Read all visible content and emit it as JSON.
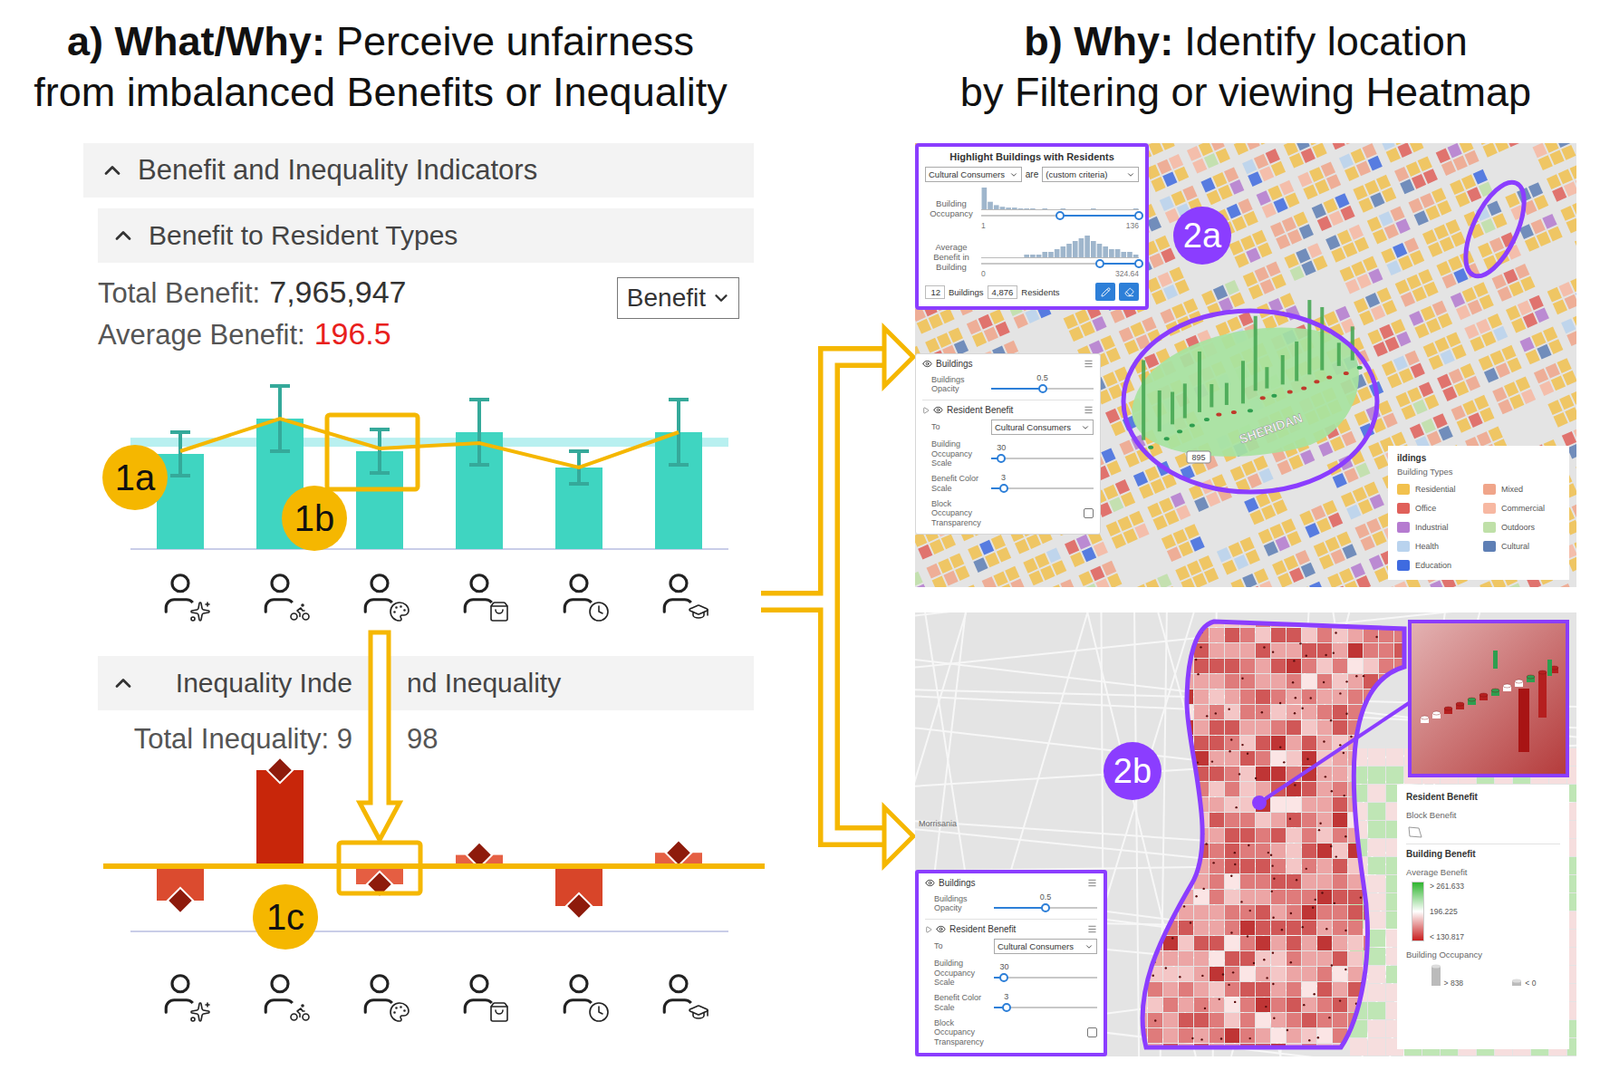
{
  "left": {
    "title": {
      "bold": "a) What/Why:",
      "line1": "Perceive unfairness",
      "line2": "from imbalanced Benefits or Inequality"
    },
    "indicators": {
      "label": "Benefit and Inequality Indicators",
      "expanded": true
    },
    "benefit": {
      "label": "Benefit to Resident Types",
      "expanded": true,
      "total_label": "Total Benefit:",
      "total": "7,965,947",
      "average_label": "Average Benefit:",
      "average": "196.5",
      "select": "Benefit",
      "mean": 196.5,
      "bars": [
        {
          "value": 175,
          "error": 40,
          "trend": 180,
          "selected": false
        },
        {
          "value": 240,
          "error": 60,
          "trend": 240,
          "selected": false
        },
        {
          "value": 180,
          "error": 40,
          "trend": 185,
          "selected": true
        },
        {
          "value": 215,
          "error": 60,
          "trend": 195,
          "selected": false
        },
        {
          "value": 150,
          "error": 30,
          "trend": 150,
          "selected": false
        },
        {
          "value": 215,
          "error": 60,
          "trend": 215,
          "selected": false
        }
      ]
    },
    "inequality": {
      "label_before": "Inequality Inde",
      "label_after": "nd Inequality",
      "expanded": true,
      "total_before": "Total Inequality: 9",
      "total_after": "98",
      "bars": [
        {
          "value": -30,
          "selected": false
        },
        {
          "value": 90,
          "selected": false
        },
        {
          "value": -15,
          "selected": true
        },
        {
          "value": 12,
          "selected": false
        },
        {
          "value": -35,
          "selected": false
        },
        {
          "value": 14,
          "selected": false
        }
      ]
    },
    "annotations": {
      "trend": "1a",
      "highlight": "1b",
      "baseline": "1c"
    }
  },
  "right": {
    "title": {
      "bold": "b) Why:",
      "line1": "Identify location",
      "line2": "by Filtering or viewing Heatmap"
    },
    "filter_map": {
      "badge": "2a",
      "road_label": "SHERIDAN",
      "shield": "895",
      "filter": {
        "title": "Highlight Buildings with Residents",
        "group": "Cultural Consumers",
        "verb": "are",
        "criteria": "(custom criteria)",
        "ranges": [
          {
            "label": "Building Occupancy",
            "min": "1",
            "max": "136",
            "range": [
              0.5,
              1
            ],
            "histogram": [
              26,
              9,
              5,
              3,
              2,
              2,
              1,
              1,
              1,
              0,
              1,
              0,
              0,
              1,
              0,
              0,
              0,
              0,
              1,
              0,
              0,
              0,
              0,
              0,
              0,
              1
            ]
          },
          {
            "label": "Average Benefit in Building",
            "min": "0",
            "max": "324.64",
            "range": [
              0.75,
              1
            ],
            "histogram": [
              0,
              0,
              0,
              0,
              0,
              0,
              0,
              1,
              1,
              1,
              2,
              2,
              3,
              4,
              5,
              6,
              7,
              8,
              6,
              5,
              4,
              3,
              3,
              2,
              2,
              1
            ]
          }
        ],
        "buildings": "12",
        "buildings_label": "Buildings",
        "residents": "4,876",
        "residents_label": "Residents"
      },
      "layers": {
        "buildings": {
          "label": "Buildings",
          "visible": true,
          "opacity_label": "Buildings Opacity",
          "opacity": "0.5",
          "opacity_level": 0.5
        },
        "benefit": {
          "label": "Resident Benefit",
          "visible": true,
          "to_label": "To",
          "to": "Cultural Consumers",
          "occupancy_label": "Building Occupancy Scale",
          "occupancy": "30",
          "occupancy_level": 0.1,
          "color_label": "Benefit Color Scale",
          "color": "3",
          "color_level": 0.12,
          "transparency_label": "Block Occupancy Transparency",
          "transparency": false
        }
      },
      "legend": {
        "title": "ildings",
        "subtitle": "Building Types",
        "types": [
          {
            "name": "Residential",
            "color": "#f2c14e"
          },
          {
            "name": "Mixed",
            "color": "#f0a58a"
          },
          {
            "name": "Office",
            "color": "#e0605a"
          },
          {
            "name": "Commercial",
            "color": "#f7b8a2"
          },
          {
            "name": "Industrial",
            "color": "#b57bd0"
          },
          {
            "name": "Outdoors",
            "color": "#bfe0a8"
          },
          {
            "name": "Health",
            "color": "#b9d3ee"
          },
          {
            "name": "Cultural",
            "color": "#5e7fb5"
          },
          {
            "name": "Education",
            "color": "#3f6be0"
          }
        ]
      }
    },
    "heat_map": {
      "badge": "2b",
      "place_label": "Morrisania",
      "layers": {
        "buildings": {
          "label": "Buildings",
          "visible": true,
          "opacity_label": "Buildings Opacity",
          "opacity": "0.5",
          "opacity_level": 0.5
        },
        "benefit": {
          "label": "Resident Benefit",
          "visible": true,
          "to_label": "To",
          "to": "Cultural Consumers",
          "occupancy_label": "Building Occupancy Scale",
          "occupancy": "30",
          "occupancy_level": 0.1,
          "color_label": "Benefit Color Scale",
          "color": "3",
          "color_level": 0.12,
          "transparency_label": "Block Occupancy Transparency",
          "transparency": false
        }
      },
      "legend": {
        "title": "Resident Benefit",
        "block_label": "Block Benefit",
        "building_label": "Building Benefit",
        "average_label": "Average Benefit",
        "stops": [
          "> 261.633",
          "196.225",
          "< 130.817"
        ],
        "occupancy_label": "Building Occupancy",
        "occupancy_stops": [
          "> 838",
          "< 0"
        ]
      }
    }
  }
}
